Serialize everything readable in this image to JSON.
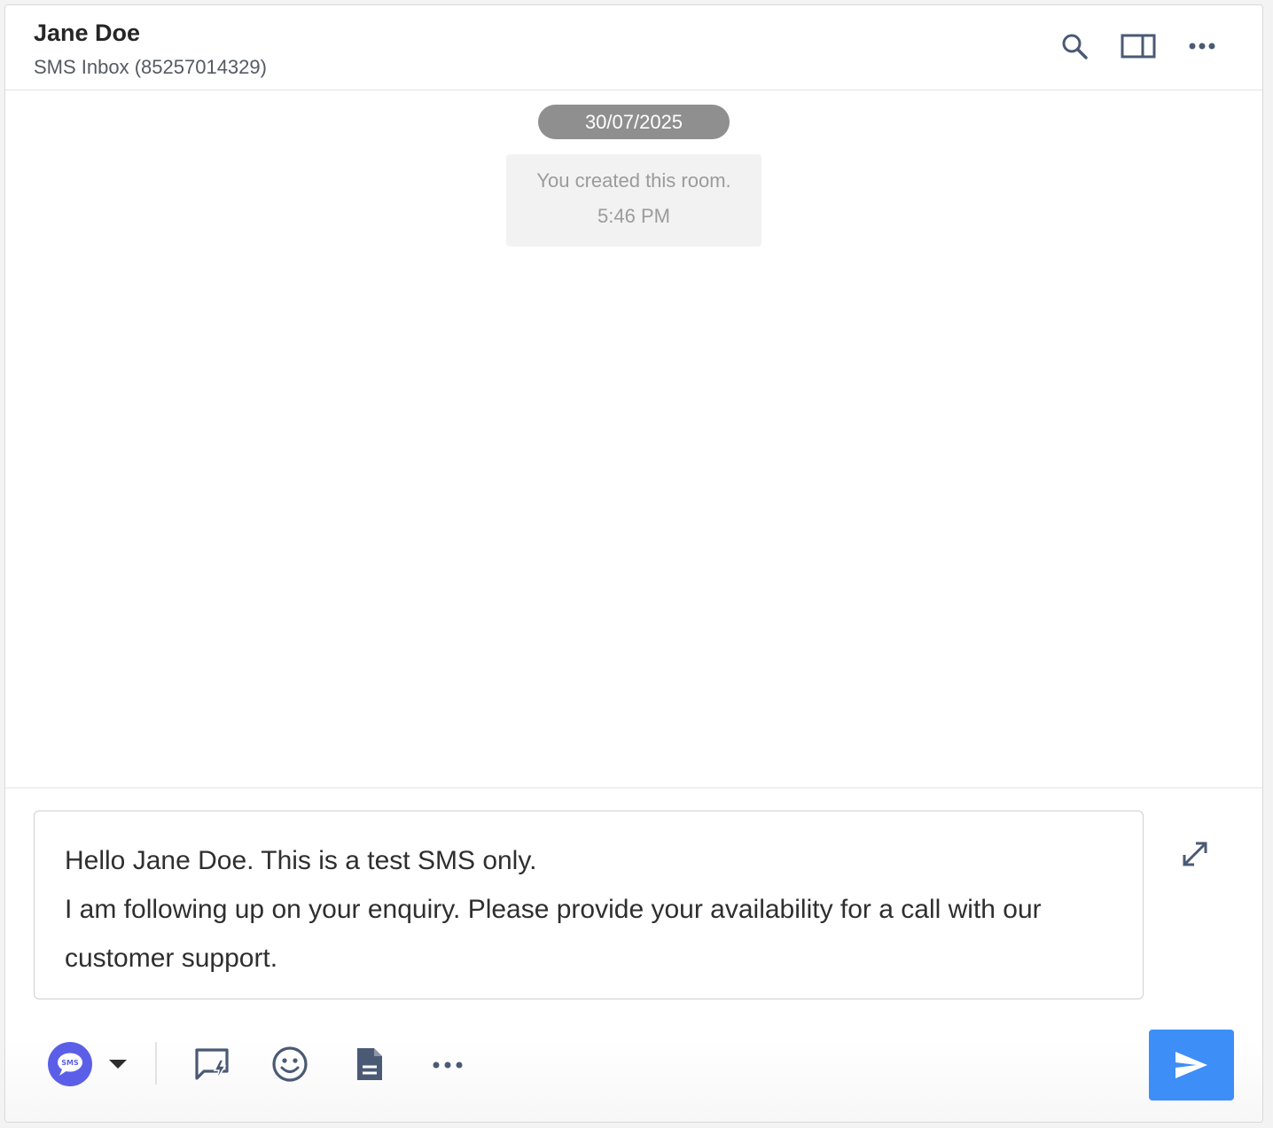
{
  "header": {
    "contact_name": "Jane Doe",
    "inbox_label": "SMS Inbox (85257014329)",
    "icons": [
      "search-icon",
      "side-panel-icon",
      "more-horizontal-icon"
    ]
  },
  "conversation": {
    "date_separator": "30/07/2025",
    "system_message": {
      "text": "You created this room.",
      "time": "5:46 PM"
    }
  },
  "composer": {
    "message_lines": [
      "Hello Jane Doe. This is a test SMS only.",
      "I am following up on your enquiry. Please provide your availability for a call with our customer support."
    ],
    "channel_badge_label": "SMS",
    "toolbar_icons": [
      "channel-dropdown-icon",
      "quick-reply-icon",
      "emoji-icon",
      "template-icon",
      "more-horizontal-icon"
    ],
    "expand_icon": "expand-icon",
    "send_icon": "send-icon"
  },
  "colors": {
    "send_button": "#3d8ef7",
    "channel_badge": "#5b5fe8",
    "icon": "#4a5a75",
    "date_pill": "#8f8f8f"
  }
}
